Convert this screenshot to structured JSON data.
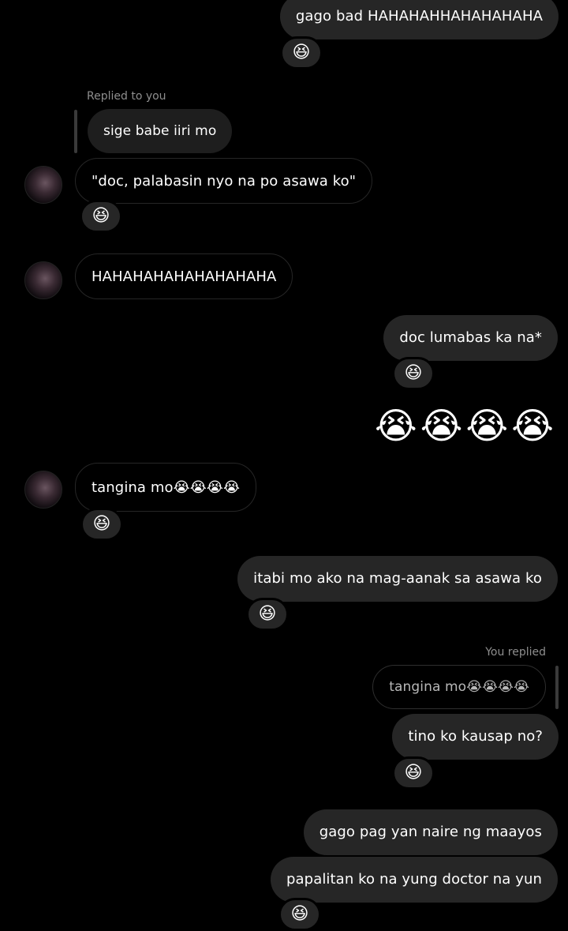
{
  "reaction_emoji": "😆",
  "messages": {
    "m1": {
      "text": "gago bad HAHAHAHHAHAHAHAHA",
      "reaction": "😆"
    },
    "m2_reply_meta": "Replied to you",
    "m2_quote": "sige babe iiri mo",
    "m2": {
      "text": "\"doc,  palabasin nyo na po asawa ko\"",
      "reaction": "😆"
    },
    "m3": {
      "text": "HAHAHAHAHAHAHAHAHA"
    },
    "m4": {
      "text": "doc lumabas ka na*",
      "reaction": "😆"
    },
    "m5": {
      "text": "😭😭😭😭"
    },
    "m6": {
      "text": "tangina mo😭😭😭😭",
      "reaction": "😆"
    },
    "m7": {
      "text": "itabi mo ako na mag-aanak sa asawa ko",
      "reaction": "😆"
    },
    "m8_reply_meta": "You replied",
    "m8_quote": "tangina mo😭😭😭😭",
    "m8": {
      "text": "tino ko kausap no?",
      "reaction": "😆"
    },
    "m9": {
      "text": "gago pag yan naire ng maayos"
    },
    "m10": {
      "text": "papalitan ko na yung doctor na yun",
      "reaction": "😆"
    }
  }
}
